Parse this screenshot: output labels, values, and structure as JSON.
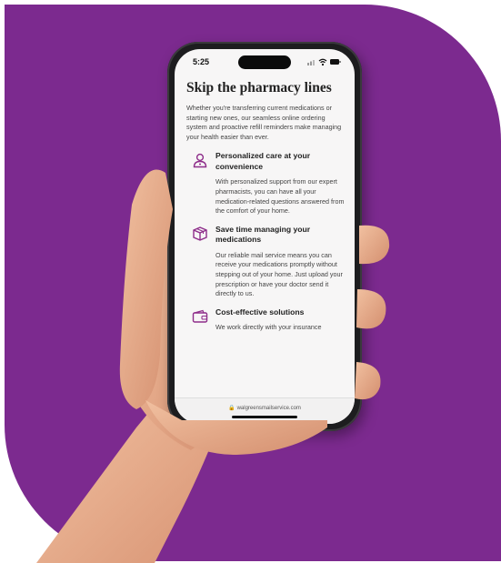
{
  "status_bar": {
    "time": "5:25"
  },
  "page": {
    "heading": "Skip the pharmacy lines",
    "intro": "Whether you're transferring current medications or starting new ones, our seamless online ordering system and proactive refill reminders make managing your health easier than ever.",
    "features": [
      {
        "icon": "person-care-icon",
        "title": "Personalized care at your convenience",
        "description": "With personalized support from our expert pharmacists, you can have all your medication-related questions answered from the comfort of your home."
      },
      {
        "icon": "package-box-icon",
        "title": "Save time managing your medications",
        "description": "Our reliable mail service means you can receive your medications promptly without stepping out of your home. Just upload your prescription or have your doctor send it directly to us."
      },
      {
        "icon": "wallet-icon",
        "title": "Cost-effective solutions",
        "description": "We work directly with your insurance"
      }
    ]
  },
  "browser": {
    "url": "walgreensmailservice.com"
  },
  "colors": {
    "brand_purple": "#7c2a8f",
    "icon_purple": "#8e2d8a"
  }
}
